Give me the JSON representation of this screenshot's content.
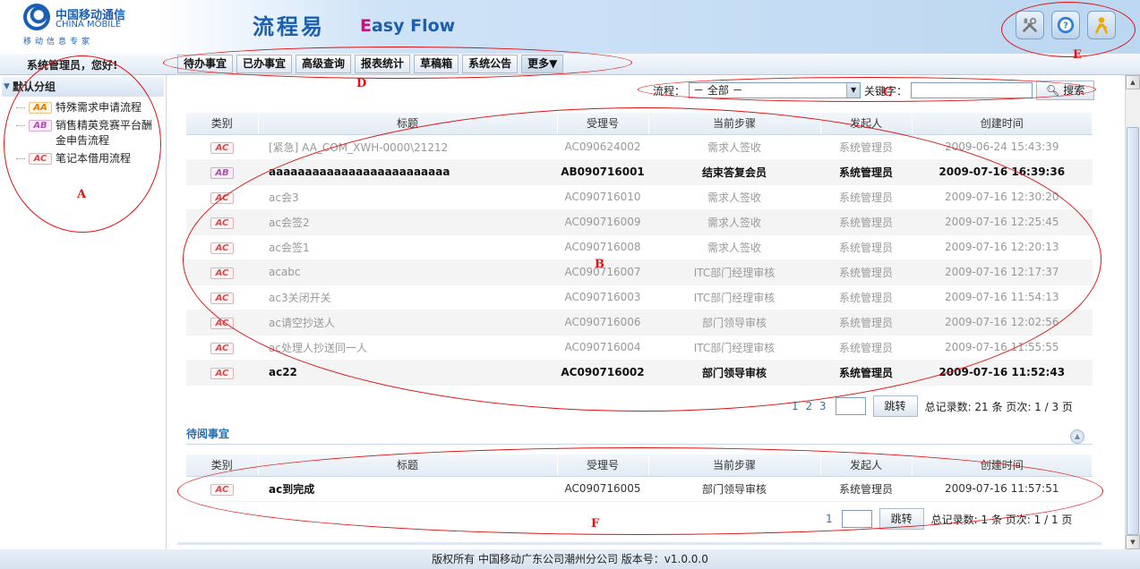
{
  "logo": {
    "cn": "中国移动通信",
    "en": "CHINA MOBILE",
    "sub": "移动信息专家"
  },
  "app": {
    "title": "流程易",
    "sub_e": "E",
    "sub_rest": "asy Flow"
  },
  "top_icons": [
    "tools-icon",
    "help-icon",
    "user-icon"
  ],
  "welcome": "系统管理员，您好!",
  "tabs": [
    "待办事宜",
    "已办事宜",
    "高级查询",
    "报表统计",
    "草稿箱",
    "系统公告",
    "更多▼"
  ],
  "sidebar": {
    "group": "默认分组",
    "items": [
      {
        "badge": "AA",
        "label": "特殊需求申请流程"
      },
      {
        "badge": "AB",
        "label": "销售精英竞赛平台酬金申告流程"
      },
      {
        "badge": "AC",
        "label": "笔记本借用流程"
      }
    ]
  },
  "filter": {
    "flow_label": "流程：",
    "flow_value": "－ 全部 －",
    "keyword_label": "关键字：",
    "search": "搜索"
  },
  "columns": [
    "类别",
    "标题",
    "受理号",
    "当前步骤",
    "发起人",
    "创建时间"
  ],
  "todo_rows": [
    {
      "badge": "AC",
      "title": "[紧急] AA_COM_XWH-0000\\21212",
      "no": "AC090624002",
      "step": "需求人签收",
      "by": "系统管理员",
      "time": "2009-06-24 15:43:39",
      "style": "normal-grey"
    },
    {
      "badge": "AB",
      "title": "aaaaaaaaaaaaaaaaaaaaaaaaa",
      "no": "AB090716001",
      "step": "结束答复会员",
      "by": "系统管理员",
      "time": "2009-07-16 16:39:36",
      "style": "bold"
    },
    {
      "badge": "AC",
      "title": "ac会3",
      "no": "AC090716010",
      "step": "需求人签收",
      "by": "系统管理员",
      "time": "2009-07-16 12:30:20",
      "style": "normal-grey"
    },
    {
      "badge": "AC",
      "title": "ac会签2",
      "no": "AC090716009",
      "step": "需求人签收",
      "by": "系统管理员",
      "time": "2009-07-16 12:25:45",
      "style": "normal-grey"
    },
    {
      "badge": "AC",
      "title": "ac会签1",
      "no": "AC090716008",
      "step": "需求人签收",
      "by": "系统管理员",
      "time": "2009-07-16 12:20:13",
      "style": "normal-grey"
    },
    {
      "badge": "AC",
      "title": "acabc",
      "no": "AC090716007",
      "step": "ITC部门经理审核",
      "by": "系统管理员",
      "time": "2009-07-16 12:17:37",
      "style": "normal-grey"
    },
    {
      "badge": "AC",
      "title": "ac3关闭开关",
      "no": "AC090716003",
      "step": "ITC部门经理审核",
      "by": "系统管理员",
      "time": "2009-07-16 11:54:13",
      "style": "normal-grey"
    },
    {
      "badge": "AC",
      "title": "ac请空抄送人",
      "no": "AC090716006",
      "step": "部门领导审核",
      "by": "系统管理员",
      "time": "2009-07-16 12:02:56",
      "style": "normal-grey"
    },
    {
      "badge": "AC",
      "title": "ac处理人抄送同一人",
      "no": "AC090716004",
      "step": "ITC部门经理审核",
      "by": "系统管理员",
      "time": "2009-07-16 11:55:55",
      "style": "normal-grey"
    },
    {
      "badge": "AC",
      "title": "ac22",
      "no": "AC090716002",
      "step": "部门领导审核",
      "by": "系统管理员",
      "time": "2009-07-16 11:52:43",
      "style": "bold"
    }
  ],
  "todo_pager": {
    "pages": "1 2 3",
    "go": "跳转",
    "summary": "总记录数: 21 条  页次: 1 / 3 页"
  },
  "read_section": {
    "title": "待阅事宜"
  },
  "read_rows": [
    {
      "badge": "AC",
      "title": "ac到完成",
      "no": "AC090716005",
      "step": "部门领导审核",
      "by": "系统管理员",
      "time": "2009-07-16 11:57:51",
      "style": "mixed"
    }
  ],
  "read_pager": {
    "pages": "1",
    "go": "跳转",
    "summary": "总记录数: 1 条  页次: 1 / 1 页"
  },
  "footer": "版权所有  中国移动广东公司潮州分公司  版本号：v1.0.0.0",
  "annotations": [
    "A",
    "B",
    "C",
    "D",
    "E",
    "F"
  ],
  "colors": {
    "annotation": "#e01010",
    "brand_blue": "#1d5fae",
    "link": "#2a6db0"
  }
}
